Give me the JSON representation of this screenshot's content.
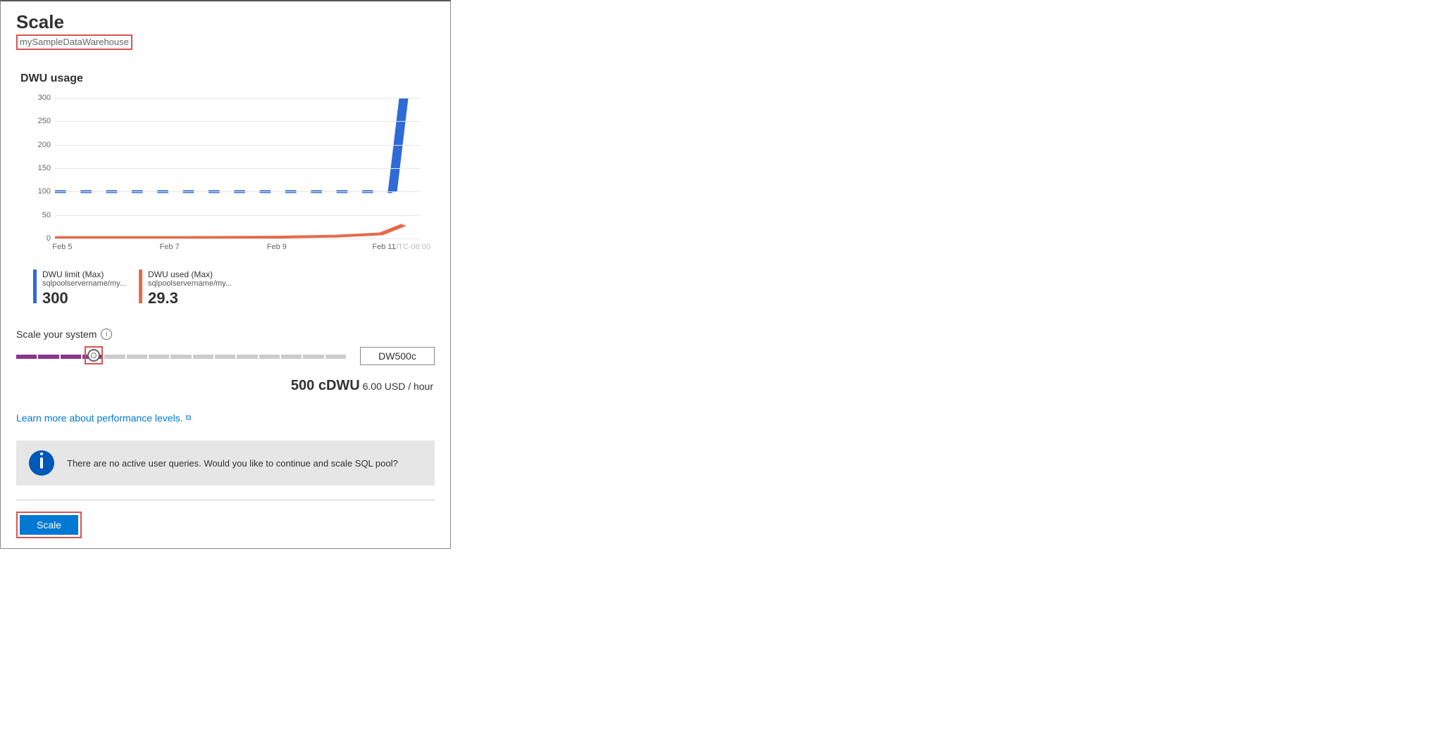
{
  "title": "Scale",
  "subtitle": "mySampleDataWarehouse",
  "usage_section_title": "DWU usage",
  "chart_data": {
    "type": "line",
    "yticks": [
      0,
      50,
      100,
      150,
      200,
      250,
      300
    ],
    "xticks": [
      "Feb 5",
      "Feb 7",
      "Feb 9",
      "Feb 11"
    ],
    "timezone": "UTC-08:00",
    "ylim": [
      0,
      300
    ],
    "series": [
      {
        "name": "DWU limit (Max)",
        "color": "#2f6bd6",
        "points": [
          {
            "x": "Feb 5",
            "y": 100
          },
          {
            "x": "Feb 7",
            "y": 100
          },
          {
            "x": "Feb 9",
            "y": 100
          },
          {
            "x": "Feb 10.5",
            "y": 100
          },
          {
            "x": "Feb 11",
            "y": 100
          },
          {
            "x": "Feb 11.2",
            "y": 300
          }
        ]
      },
      {
        "name": "DWU used (Max)",
        "color": "#e66a4a",
        "points": [
          {
            "x": "Feb 5",
            "y": 2
          },
          {
            "x": "Feb 7",
            "y": 2
          },
          {
            "x": "Feb 9",
            "y": 3
          },
          {
            "x": "Feb 10",
            "y": 5
          },
          {
            "x": "Feb 10.8",
            "y": 10
          },
          {
            "x": "Feb 11.2",
            "y": 29
          }
        ]
      }
    ]
  },
  "legend": [
    {
      "title": "DWU limit (Max)",
      "sub": "sqlpoolservername/my...",
      "value": "300",
      "color": "blue"
    },
    {
      "title": "DWU used (Max)",
      "sub": "sqlpoolservername/my...",
      "value": "29.3",
      "color": "orange"
    }
  ],
  "scale_label": "Scale your system",
  "slider": {
    "value_label": "DW500c",
    "filled_segments": 4,
    "total_segments": 15,
    "handle_pct": 24
  },
  "price": {
    "big": "500 cDWU",
    "small": "6.00 USD / hour"
  },
  "learn_more": "Learn more about performance levels.",
  "info_message": "There are no active user queries. Would you like to continue and scale SQL pool?",
  "scale_button": "Scale"
}
